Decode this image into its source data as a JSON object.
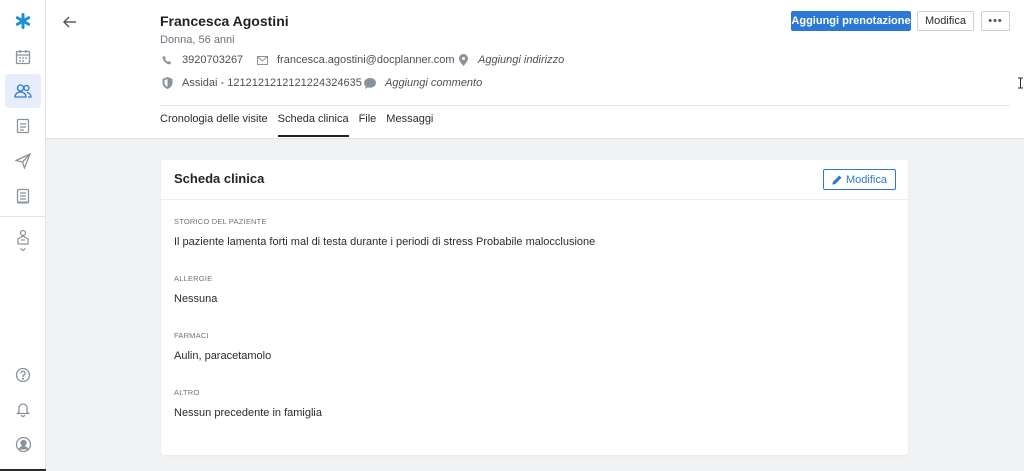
{
  "sidebar": {
    "items": [
      {
        "icon": "app-logo-icon"
      },
      {
        "icon": "calendar-icon"
      },
      {
        "icon": "patients-icon",
        "active": true
      },
      {
        "icon": "document-icon"
      },
      {
        "icon": "send-icon"
      },
      {
        "icon": "ledger-icon"
      },
      {
        "icon": "clinic-icon"
      },
      {
        "icon": "help-icon"
      },
      {
        "icon": "bell-icon"
      },
      {
        "icon": "user-account-icon"
      }
    ]
  },
  "patient": {
    "name": "Francesca Agostini",
    "subtitle": "Donna, 56 anni",
    "phone": "3920703267",
    "email": "francesca.agostini@docplanner.com",
    "address_placeholder": "Aggiungi indirizzo",
    "insurance": "Assidai - 1212121212121224324635",
    "comment_placeholder": "Aggiungi commento"
  },
  "header": {
    "primary_button": "Aggiungi prenotazione",
    "edit_button": "Modifica",
    "more_button": "•••"
  },
  "tabs": [
    {
      "label": "Cronologia delle visite",
      "active": false
    },
    {
      "label": "Scheda clinica",
      "active": true
    },
    {
      "label": "File",
      "active": false
    },
    {
      "label": "Messaggi",
      "active": false
    }
  ],
  "card": {
    "title": "Scheda clinica",
    "edit_button": "Modifica",
    "sections": [
      {
        "label": "STORICO DEL PAZIENTE",
        "value": "Il paziente lamenta forti mal di testa durante i periodi di stress Probabile malocclusione"
      },
      {
        "label": "ALLERGIE",
        "value": "Nessuna"
      },
      {
        "label": "FARMACI",
        "value": "Aulin, paracetamolo"
      },
      {
        "label": "ALTRO",
        "value": "Nessun precedente in famiglia"
      }
    ]
  },
  "colors": {
    "accent": "#2c78d6",
    "logo": "#1a8fd6",
    "active_nav_bg": "#e7eef9"
  }
}
